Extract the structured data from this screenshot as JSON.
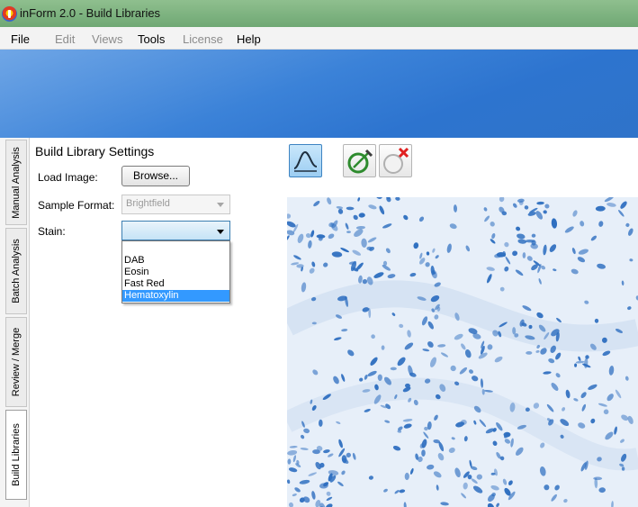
{
  "window": {
    "title": "inForm 2.0 - Build Libraries"
  },
  "menu": [
    {
      "label": "File",
      "enabled": true
    },
    {
      "label": "Edit",
      "enabled": false
    },
    {
      "label": "Views",
      "enabled": false
    },
    {
      "label": "Tools",
      "enabled": true
    },
    {
      "label": "License",
      "enabled": false
    },
    {
      "label": "Help",
      "enabled": true
    }
  ],
  "vertical_tabs": [
    {
      "label": "Manual Analysis",
      "active": false
    },
    {
      "label": "Batch Analysis",
      "active": false
    },
    {
      "label": "Review / Merge",
      "active": false
    },
    {
      "label": "Build Libraries",
      "active": true
    }
  ],
  "settings": {
    "title": "Build Library Settings",
    "load_image_label": "Load Image:",
    "browse_label": "Browse...",
    "sample_format_label": "Sample Format:",
    "sample_format_value": "Brightfield",
    "stain_label": "Stain:",
    "stain_value": "",
    "stain_options": [
      "DAB",
      "Eosin",
      "Fast Red",
      "Hematoxylin"
    ],
    "stain_highlighted": "Hematoxylin"
  },
  "toolbar": {
    "curve_icon": "spectrum-curve-icon",
    "edit_icon": "draw-region-icon",
    "clear_icon": "clear-region-icon"
  },
  "colors": {
    "banner": "#3b82d8",
    "titlebar": "#7fb47f",
    "selection": "#3399ff",
    "stain_blue": "#2f6fc0"
  }
}
